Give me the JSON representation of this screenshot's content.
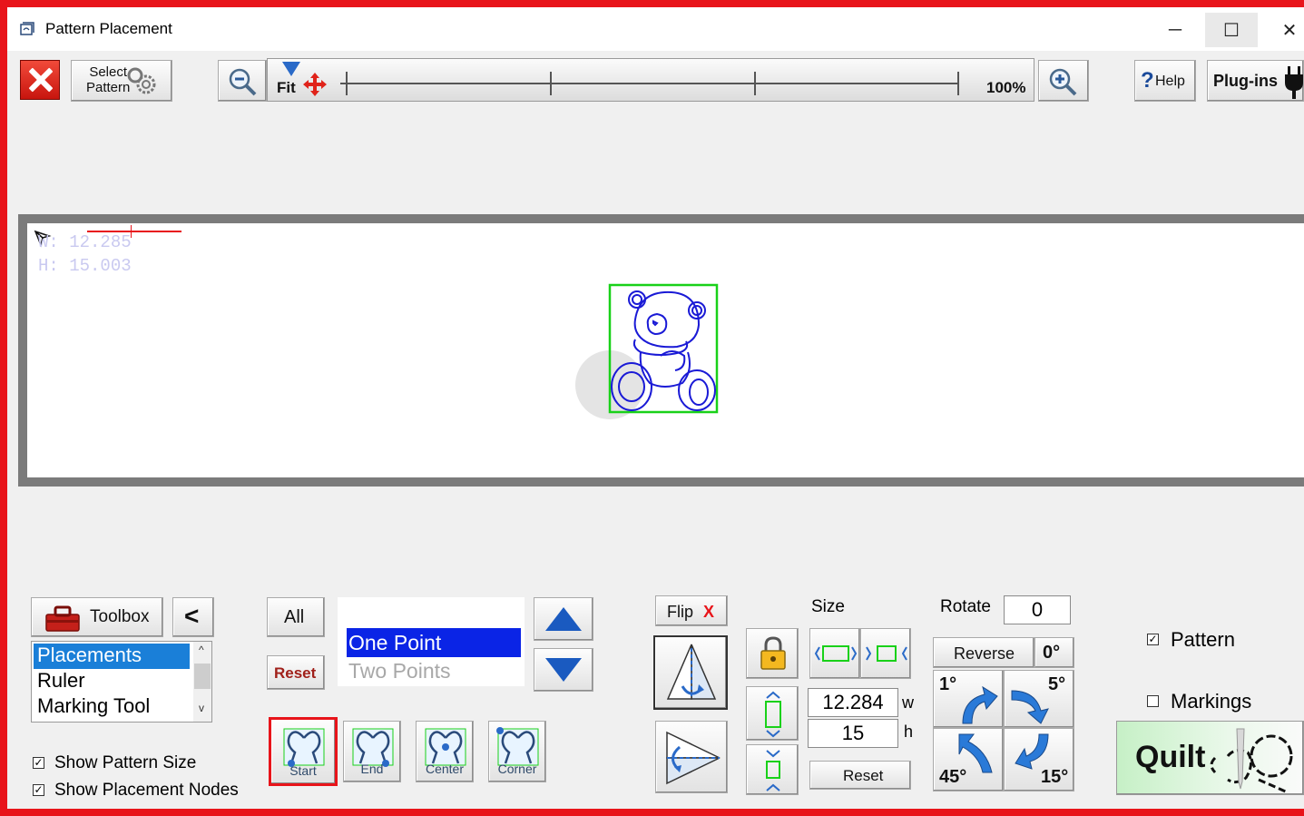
{
  "window": {
    "title": "Pattern Placement",
    "minimize": "─",
    "maximize": "☐",
    "close": "✕"
  },
  "toolbar": {
    "select_pattern_line1": "Select",
    "select_pattern_line2": "Pattern",
    "fit_label": "Fit",
    "zoom_percent": "100%",
    "help_label": "Help",
    "plugins_label": "Plug-ins"
  },
  "canvas": {
    "width_readout": "W: 12.285",
    "height_readout": "H: 15.003"
  },
  "toolbox": {
    "button_label": "Toolbox",
    "collapse_label": "<",
    "items": [
      "Placements",
      "Ruler",
      "Marking Tool"
    ],
    "selected": "Placements"
  },
  "options": {
    "show_pattern_size": "Show Pattern Size",
    "show_placement_nodes": "Show Placement Nodes"
  },
  "placement": {
    "all_label": "All",
    "reset_label": "Reset",
    "modes": [
      "One Point",
      "Two Points"
    ],
    "selected_mode": "One Point",
    "nodes": [
      "Start",
      "End",
      "Center",
      "Corner"
    ],
    "selected_node": "Start"
  },
  "flip": {
    "label": "Flip",
    "x_mark": "X"
  },
  "size": {
    "label": "Size",
    "width_value": "12.284",
    "width_unit": "w",
    "height_value": "15",
    "height_unit": "h",
    "reset_label": "Reset"
  },
  "rotate": {
    "label": "Rotate",
    "value": "0",
    "reverse_label": "Reverse",
    "zero_label": "0°",
    "steps": [
      "1°",
      "5°",
      "45°",
      "15°"
    ]
  },
  "visibility": {
    "pattern_label": "Pattern",
    "pattern_checked": true,
    "markings_label": "Markings",
    "markings_checked": false
  },
  "quilt": {
    "label": "Quilt"
  },
  "colors": {
    "frame_red": "#e8141a",
    "selection_blue": "#0a24e6",
    "pattern_blue": "#1a1ad6",
    "bbox_green": "#19d119",
    "arrow_blue": "#2a7ad8"
  }
}
